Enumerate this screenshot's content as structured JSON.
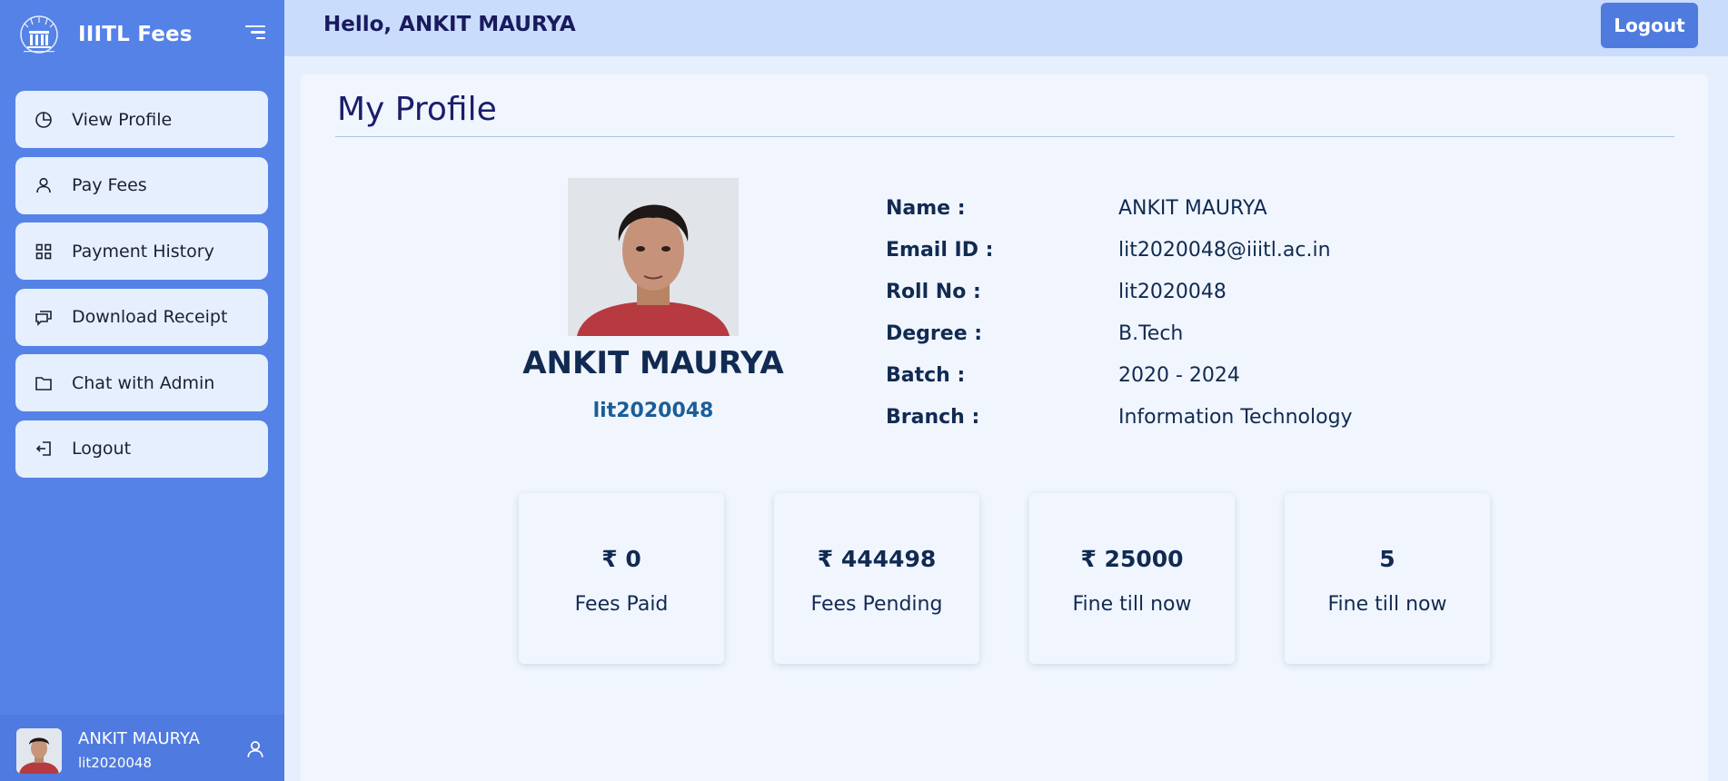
{
  "app": {
    "brand_title": "IIITL Fees",
    "colors": {
      "sidebar": "#5582e6",
      "topbar": "#c9dcfb",
      "accent": "#4f7bdf",
      "panel": "#f1f6fe"
    }
  },
  "sidebar": {
    "items": [
      {
        "label": "View Profile",
        "icon": "pie-chart-icon"
      },
      {
        "label": "Pay Fees",
        "icon": "user-icon"
      },
      {
        "label": "Payment History",
        "icon": "grid-icon"
      },
      {
        "label": "Download Receipt",
        "icon": "chat-icon"
      },
      {
        "label": "Chat with Admin",
        "icon": "folder-icon"
      },
      {
        "label": "Logout",
        "icon": "logout-icon"
      }
    ],
    "footer": {
      "name": "ANKIT MAURYA",
      "roll": "lit2020048"
    }
  },
  "topbar": {
    "greeting": "Hello, ANKIT MAURYA",
    "logout_label": "Logout"
  },
  "main": {
    "title": "My Profile",
    "profile": {
      "name": "ANKIT MAURYA",
      "roll": "lit2020048"
    },
    "details": [
      {
        "label": "Name :",
        "value": "ANKIT MAURYA"
      },
      {
        "label": "Email ID :",
        "value": "lit2020048@iiitl.ac.in"
      },
      {
        "label": "Roll No :",
        "value": "lit2020048"
      },
      {
        "label": "Degree :",
        "value": "B.Tech"
      },
      {
        "label": "Batch :",
        "value": "2020 - 2024"
      },
      {
        "label": "Branch :",
        "value": "Information Technology"
      }
    ],
    "stats": [
      {
        "value": "₹ 0",
        "label": "Fees Paid"
      },
      {
        "value": "₹ 444498",
        "label": "Fees Pending"
      },
      {
        "value": "₹ 25000",
        "label": "Fine till now"
      },
      {
        "value": "5",
        "label": "Fine till now"
      }
    ]
  }
}
